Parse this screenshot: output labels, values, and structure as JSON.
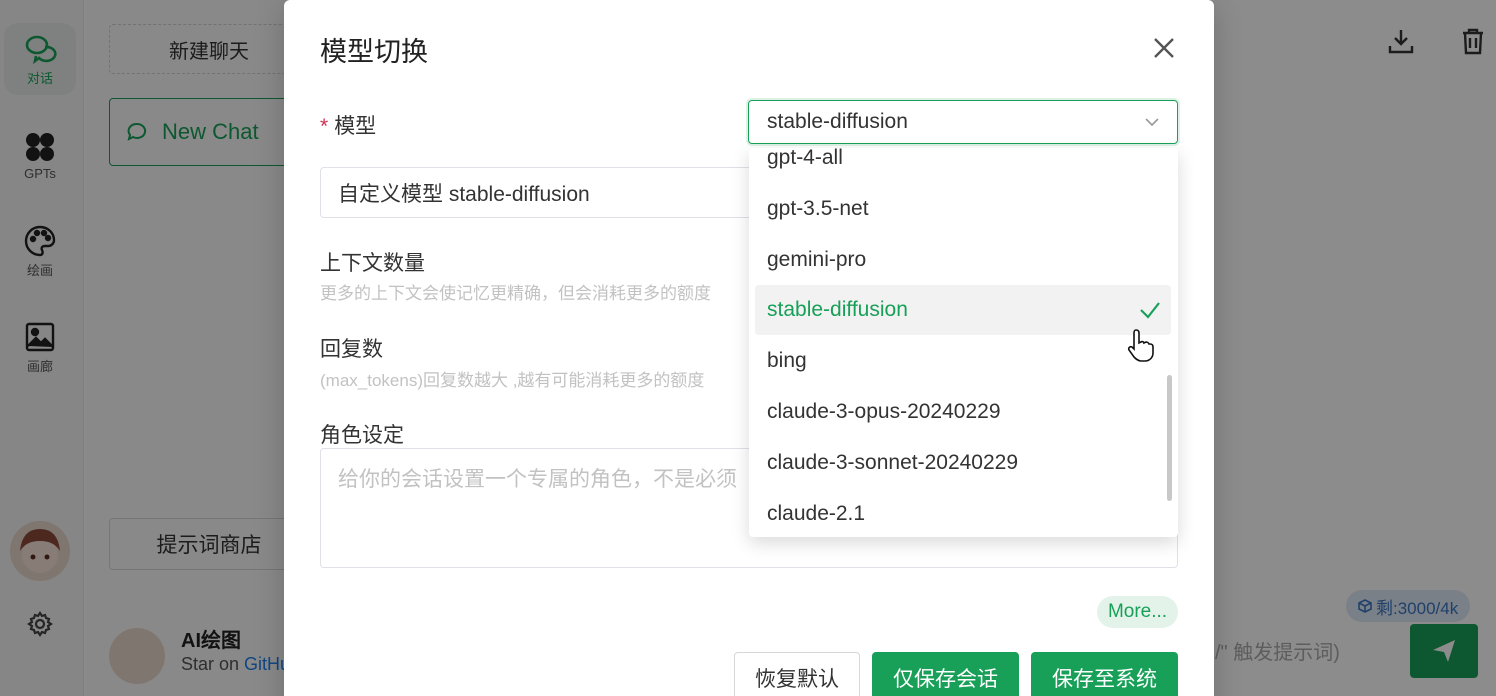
{
  "sidebar": {
    "items": [
      {
        "label": "对话",
        "icon": "chat-bubbles-icon"
      },
      {
        "label": "GPTs",
        "icon": "grid-icon"
      },
      {
        "label": "绘画",
        "icon": "palette-icon"
      },
      {
        "label": "画廊",
        "icon": "image-icon"
      }
    ],
    "settings_icon": "gear-icon"
  },
  "chat_list": {
    "new_dialog_label": "新建聊天",
    "items": [
      {
        "label": "New Chat"
      }
    ],
    "prompt_store_label": "提示词商店",
    "profile": {
      "name": "AI绘图",
      "subtitle_prefix": "Star on ",
      "subtitle_link": "GitHub"
    }
  },
  "main": {
    "token_badge": "剩:3000/4k",
    "input_placeholder": "/\" 触发提示词)",
    "topbar_icons": [
      "download-icon",
      "trash-icon"
    ]
  },
  "modal": {
    "title": "模型切换",
    "model_label": "模型",
    "model_value": "stable-diffusion",
    "custom_model_value": "自定义模型 stable-diffusion",
    "context_label": "上下文数量",
    "context_desc": "更多的上下文会使记忆更精确，但会消耗更多的额度",
    "reply_label": "回复数",
    "reply_desc": "(max_tokens)回复数越大 ,越有可能消耗更多的额度",
    "role_label": "角色设定",
    "role_placeholder": "给你的会话设置一个专属的角色，不是必须",
    "more_label": "More...",
    "buttons": {
      "reset": "恢复默认",
      "save_session": "仅保存会话",
      "save_system": "保存至系统"
    }
  },
  "dropdown": {
    "options": [
      "gpt-4-all",
      "gpt-3.5-net",
      "gemini-pro",
      "stable-diffusion",
      "bing",
      "claude-3-opus-20240229",
      "claude-3-sonnet-20240229",
      "claude-2.1"
    ],
    "selected": "stable-diffusion"
  },
  "colors": {
    "accent": "#18a058",
    "danger": "#d03050",
    "badge": "#3b76c4"
  }
}
